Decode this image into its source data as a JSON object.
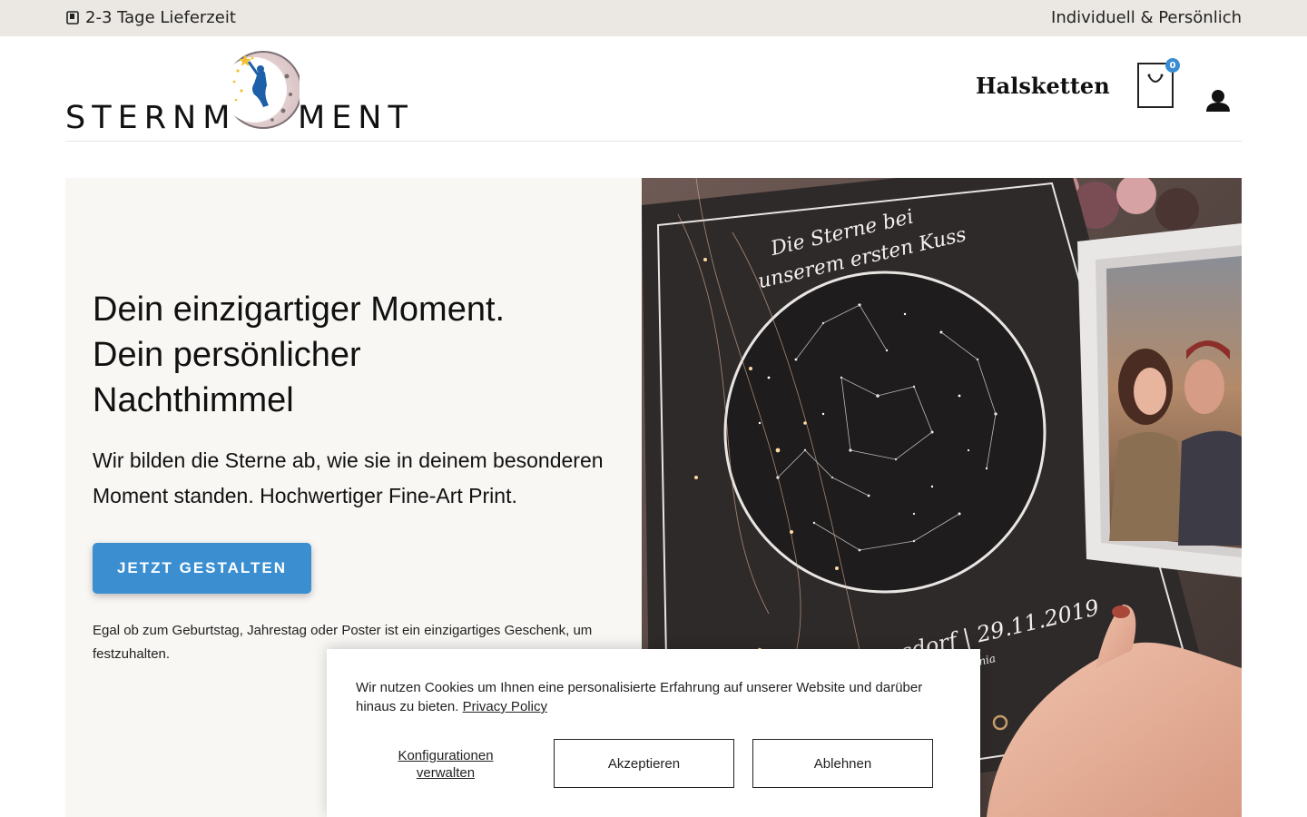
{
  "topbar": {
    "shipping_text": "2-3 Tage Lieferzeit",
    "tagline": "Individuell & Persönlich"
  },
  "header": {
    "logo_left": "STERNM",
    "logo_right": "MENT",
    "nav_item": "Halsketten",
    "cart_count": "0"
  },
  "hero": {
    "title_line1": "Dein einzigartiger Moment.",
    "title_line2": "Dein persönlicher",
    "title_line3": "Nachthimmel",
    "subtitle": "Wir bilden die Sterne ab, wie sie in deinem besonderen Moment standen. Hochwertiger Fine-Art Print.",
    "cta_label": "JETZT GESTALTEN",
    "small_text": "Egal ob zum Geburtstag, Jahrestag oder Poster ist ein einzigartiges Geschenk, um festzuhalten."
  },
  "poster": {
    "headline_line1": "Die Sterne bei",
    "headline_line2": "unserem ersten Kuss",
    "place_date": "Hermsdorf | 29.11.2019",
    "names": "Antonia"
  },
  "cookie": {
    "text": "Wir nutzen Cookies um Ihnen eine personalisierte Erfahrung auf unserer Website und darüber hinaus zu bieten.",
    "privacy_link": "Privacy Policy",
    "config_label": "Konfigurationen verwalten",
    "accept_label": "Akzeptieren",
    "decline_label": "Ablehnen"
  },
  "colors": {
    "topbar_bg": "#ebe8e3",
    "accent_blue": "#3b8fd1",
    "hero_bg": "#f8f7f4"
  },
  "icons": {
    "shipping": "truck-icon",
    "cart": "shopping-bag-icon",
    "user": "user-icon"
  }
}
